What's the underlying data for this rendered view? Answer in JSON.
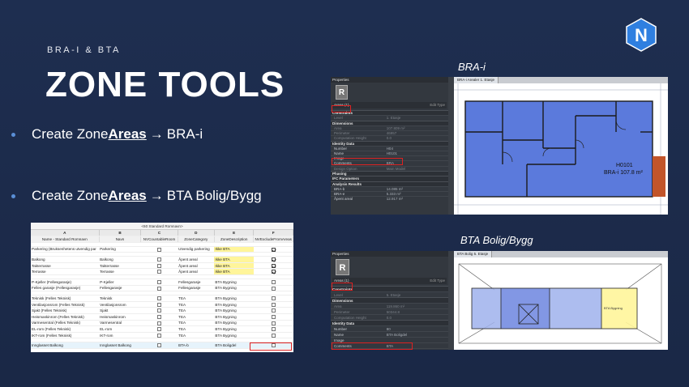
{
  "slide": {
    "kicker": "BRA-I & BTA",
    "title": "ZONE TOOLS",
    "bullets": [
      {
        "prefix": "Create Zone ",
        "bold": "Areas",
        "arrow": "→",
        "suffix": " BRA-i"
      },
      {
        "prefix": "Create Zone ",
        "bold": "Areas",
        "arrow": "→",
        "suffix": " BTA Bolig/Bygg"
      }
    ],
    "logo_letter": "N",
    "caption_top": "BRA-i",
    "caption_bottom": "BTA Bolig/Bygg"
  },
  "schedule": {
    "title": "<60 Standard Romnavn>",
    "columns": [
      "A",
      "B",
      "C",
      "D",
      "E",
      "F"
    ],
    "headers": [
      "Name - Standard Romnavn",
      "Navn",
      "NVCountableRoom",
      "ZoneCategory",
      "ZoneDescription",
      "NVExcludeFromAreas"
    ],
    "groups": [
      [
        {
          "name": "Parkering (Bruksenhetens utvendig par",
          "navn": "Parkering",
          "countable": false,
          "cat": "Utvendig parkering",
          "desc": "Ikke BTA",
          "desc_hl": "yellow",
          "exclude": true
        }
      ],
      [
        {
          "name": "Balkong",
          "navn": "Balkong",
          "countable": false,
          "cat": "Åpent areal",
          "desc": "Ikke BTA",
          "desc_hl": "yellow",
          "exclude": true
        },
        {
          "name": "Takterrasse",
          "navn": "Takterrasse",
          "countable": false,
          "cat": "Åpent areal",
          "desc": "Ikke BTA",
          "desc_hl": "yellow",
          "exclude": true
        },
        {
          "name": "Terrasse",
          "navn": "Terrasse",
          "countable": false,
          "cat": "Åpent areal",
          "desc": "Ikke BTA",
          "desc_hl": "yellow",
          "exclude": true
        }
      ],
      [
        {
          "name": "P-Kjeller (Fellesgarasje)",
          "navn": "P-Kjeller",
          "countable": false,
          "cat": "Fellesgarasje",
          "desc": "BTA Bygning",
          "desc_hl": "",
          "exclude": false
        },
        {
          "name": "Felles garasje (Fellesgarasje)",
          "navn": "Fellesgarasje",
          "countable": false,
          "cat": "Fellesgarasje",
          "desc": "BTA Bygning",
          "desc_hl": "",
          "exclude": false
        }
      ],
      [
        {
          "name": "Teknisk (Felles Teknisk)",
          "navn": "Teknisk",
          "countable": false,
          "cat": "TEA",
          "desc": "BTA Bygning",
          "desc_hl": "",
          "exclude": false
        },
        {
          "name": "Ventilasjonsrom (Felles Teknisk)",
          "navn": "Ventilasjonsrom",
          "countable": false,
          "cat": "TEA",
          "desc": "BTA Bygning",
          "desc_hl": "",
          "exclude": false
        },
        {
          "name": "Sjakt (Felles Teknisk)",
          "navn": "Sjakt",
          "countable": false,
          "cat": "TEA",
          "desc": "BTA Bygning",
          "desc_hl": "",
          "exclude": false
        },
        {
          "name": "Heismaskinrom (Felles Teknisk)",
          "navn": "Heismaskinrom",
          "countable": false,
          "cat": "TEA",
          "desc": "BTA Bygning",
          "desc_hl": "",
          "exclude": false
        },
        {
          "name": "Varmesentral (Felles Teknisk)",
          "navn": "Varmesentral",
          "countable": false,
          "cat": "TEA",
          "desc": "BTA Bygning",
          "desc_hl": "",
          "exclude": false
        },
        {
          "name": "EL-rom (Felles Teknisk)",
          "navn": "EL-rom",
          "countable": false,
          "cat": "TEA",
          "desc": "BTA Bygning",
          "desc_hl": "",
          "exclude": false
        },
        {
          "name": "IKT-rom (Felles Teknisk)",
          "navn": "IKT-rom",
          "countable": false,
          "cat": "TEA",
          "desc": "BTA Bygning",
          "desc_hl": "",
          "exclude": false
        }
      ],
      [
        {
          "name": "Innglasset Balkong",
          "navn": "Innglasset Balkong",
          "countable": false,
          "cat": "BTA-b",
          "desc": "BTA Boligdel",
          "desc_hl": "",
          "cat_hl": "green",
          "exclude": false,
          "last": true
        }
      ]
    ]
  },
  "revit_top": {
    "header": "Properties",
    "type_selector": "Areas (1)",
    "edit_type": "Edit Type",
    "view_tab": "BRA-i Arealer 1. Etasje",
    "rows": [
      {
        "t": "sect",
        "k": "Constraints"
      },
      {
        "t": "dim",
        "k": "Level",
        "v": "1. Etasje"
      },
      {
        "t": "sect",
        "k": "Dimensions"
      },
      {
        "t": "dim",
        "k": "Area",
        "v": "107.809 m²"
      },
      {
        "t": "dim",
        "k": "Perimeter",
        "v": "46957"
      },
      {
        "t": "dim",
        "k": "Computation Height",
        "v": "0.0"
      },
      {
        "t": "sect",
        "k": "Identity Data"
      },
      {
        "t": "row",
        "k": "Number",
        "v": "H04"
      },
      {
        "t": "row",
        "k": "Name",
        "v": "H0101"
      },
      {
        "t": "row",
        "k": "Image",
        "v": ""
      },
      {
        "t": "row",
        "k": "Comments",
        "v": "BRA"
      },
      {
        "t": "dim",
        "k": "Design Option",
        "v": "Main Model"
      },
      {
        "t": "sect",
        "k": "Phasing"
      },
      {
        "t": "sect",
        "k": "IFC Parameters"
      },
      {
        "t": "sect",
        "k": "Analysis Results"
      },
      {
        "t": "row",
        "k": "BRA-b",
        "v": "14.085 m²"
      },
      {
        "t": "row",
        "k": "BRA-e",
        "v": "5.333 m²"
      },
      {
        "t": "row",
        "k": "Åpent areal",
        "v": "12.917 m²"
      }
    ],
    "room_label": "H0101",
    "room_area": "BRA-i 107.8 m²"
  },
  "revit_bottom": {
    "header": "Properties",
    "type_selector": "Areas (1)",
    "edit_type": "Edit Type",
    "view_tab": "BTA Bolig 5. Etasje",
    "rows": [
      {
        "t": "sect",
        "k": "Constraints"
      },
      {
        "t": "dim",
        "k": "Level",
        "v": "5. Etasje"
      },
      {
        "t": "sect",
        "k": "Dimensions"
      },
      {
        "t": "dim",
        "k": "Area",
        "v": "119.860 m²"
      },
      {
        "t": "dim",
        "k": "Perimeter",
        "v": "50344.8"
      },
      {
        "t": "dim",
        "k": "Computation Height",
        "v": "0.0"
      },
      {
        "t": "sect",
        "k": "Identity Data"
      },
      {
        "t": "row",
        "k": "Number",
        "v": "80"
      },
      {
        "t": "row",
        "k": "Name",
        "v": "BTA Boligdel"
      },
      {
        "t": "row",
        "k": "Image",
        "v": ""
      },
      {
        "t": "row",
        "k": "Comments",
        "v": "BTA"
      },
      {
        "t": "dim",
        "k": "Design Option",
        "v": "Main Model"
      }
    ],
    "zone_label": "BTA Bygning"
  },
  "colors": {
    "background": "#1c2b4a",
    "accent": "#5a8fd6",
    "area_blue": "#4d6fd9",
    "highlight_red": "#d22222",
    "yellow": "#fff59a"
  }
}
